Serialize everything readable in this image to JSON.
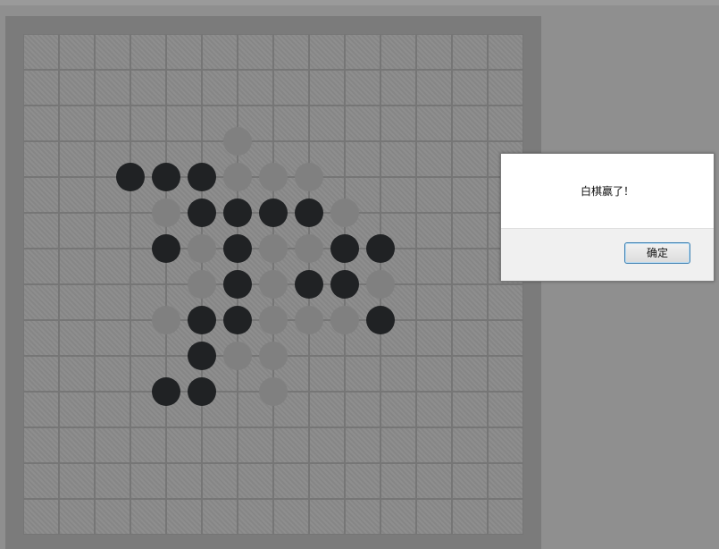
{
  "game": {
    "board_size": 15,
    "stones": {
      "black": [
        [
          3,
          4
        ],
        [
          4,
          4
        ],
        [
          5,
          4
        ],
        [
          5,
          5
        ],
        [
          6,
          5
        ],
        [
          7,
          5
        ],
        [
          8,
          5
        ],
        [
          4,
          6
        ],
        [
          6,
          6
        ],
        [
          9,
          6
        ],
        [
          10,
          6
        ],
        [
          6,
          7
        ],
        [
          8,
          7
        ],
        [
          9,
          7
        ],
        [
          5,
          8
        ],
        [
          6,
          8
        ],
        [
          10,
          8
        ],
        [
          5,
          9
        ],
        [
          4,
          10
        ],
        [
          5,
          10
        ]
      ],
      "white": [
        [
          6,
          3
        ],
        [
          6,
          4
        ],
        [
          7,
          4
        ],
        [
          8,
          4
        ],
        [
          4,
          5
        ],
        [
          9,
          5
        ],
        [
          5,
          6
        ],
        [
          7,
          6
        ],
        [
          8,
          6
        ],
        [
          5,
          7
        ],
        [
          7,
          7
        ],
        [
          10,
          7
        ],
        [
          4,
          8
        ],
        [
          7,
          8
        ],
        [
          8,
          8
        ],
        [
          9,
          8
        ],
        [
          6,
          9
        ],
        [
          7,
          9
        ],
        [
          7,
          10
        ]
      ]
    },
    "colors": {
      "black_stone": "#202224",
      "white_stone": "#808080"
    }
  },
  "dialog": {
    "message": "白棋赢了！",
    "ok_label": "确定"
  }
}
